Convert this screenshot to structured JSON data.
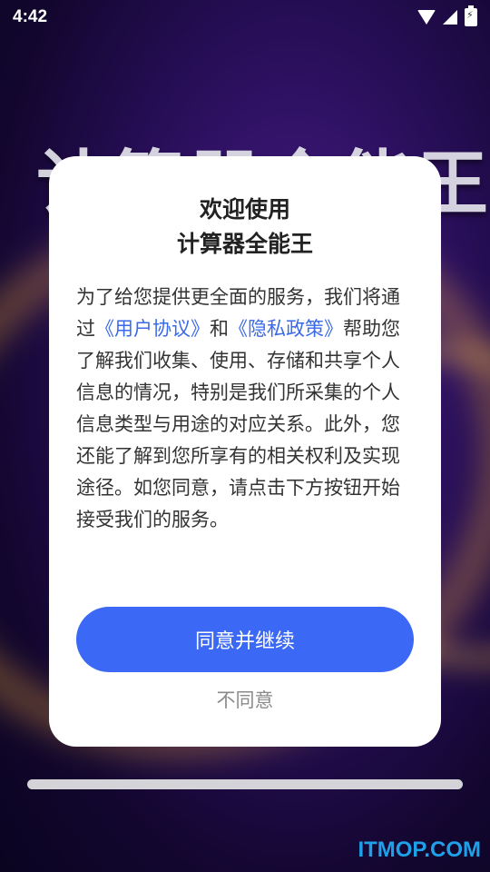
{
  "status_bar": {
    "time": "4:42",
    "icons": [
      "wifi-icon",
      "signal-icon",
      "battery-charging-icon"
    ]
  },
  "background": {
    "title": "计算器全能王"
  },
  "dialog": {
    "title_line1": "欢迎使用",
    "title_line2": "计算器全能王",
    "body_part1": "为了给您提供更全面的服务，我们将通过",
    "link_user_agreement": "《用户协议》",
    "body_and": "和",
    "link_privacy_policy": "《隐私政策》",
    "body_part2": "帮助您了解我们收集、使用、存储和共享个人信息的情况，特别是我们所采集的个人信息类型与用途的对应关系。此外，您还能了解到您所享有的相关权利及实现途径。如您同意，请点击下方按钮开始接受我们的服务。",
    "agree_label": "同意并继续",
    "disagree_label": "不同意"
  },
  "watermark": "ITMOP.COM",
  "colors": {
    "accent": "#3b68f4",
    "link": "#3b6ae8",
    "watermark": "#1fa0e8"
  }
}
